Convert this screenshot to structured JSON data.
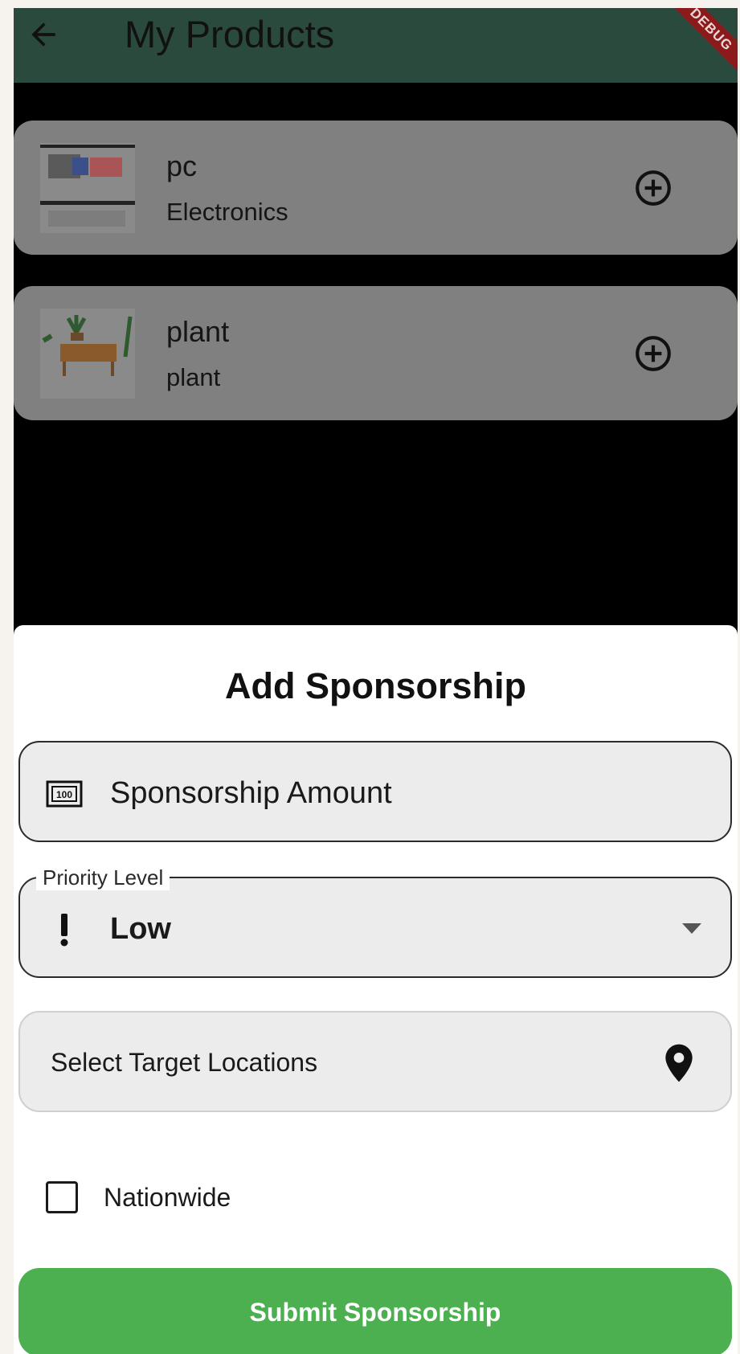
{
  "appbar": {
    "title": "My Products",
    "back_icon": "arrow-left-icon",
    "debug_label": "DEBUG"
  },
  "products": [
    {
      "name": "pc",
      "category": "Electronics",
      "action_icon": "add-circle-icon"
    },
    {
      "name": "plant",
      "category": "plant",
      "action_icon": "add-circle-icon"
    }
  ],
  "sheet": {
    "title": "Add Sponsorship",
    "amount_field": {
      "placeholder": "Sponsorship Amount",
      "icon": "money-icon"
    },
    "priority_field": {
      "label": "Priority Level",
      "value": "Low",
      "icon": "priority-exclamation-icon"
    },
    "locations_field": {
      "placeholder": "Select Target Locations",
      "icon": "location-pin-icon"
    },
    "nationwide": {
      "label": "Nationwide",
      "checked": false
    },
    "submit_label": "Submit Sponsorship"
  },
  "colors": {
    "appbar": "#2b4a3e",
    "submit": "#4caf50",
    "card": "#808080",
    "debug": "#8b1a1a"
  }
}
